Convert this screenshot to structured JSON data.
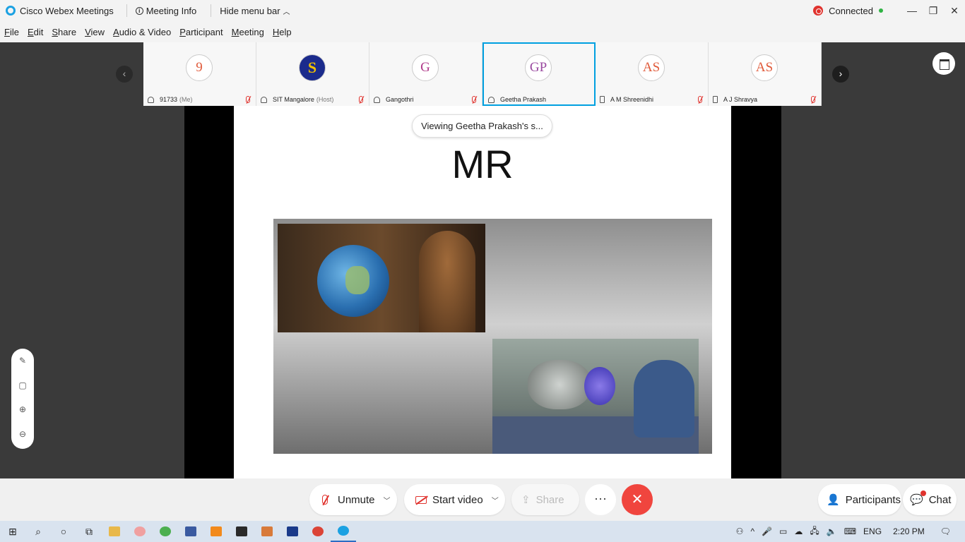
{
  "titlebar": {
    "app_name": "Cisco Webex Meetings",
    "meeting_info": "Meeting Info",
    "hide_menu": "Hide menu bar",
    "status": "Connected",
    "minimize": "—",
    "restore": "❐",
    "close": "✕"
  },
  "menu": {
    "file": "File",
    "edit": "Edit",
    "share": "Share",
    "view": "View",
    "audio_video": "Audio & Video",
    "participant": "Participant",
    "meeting": "Meeting",
    "help": "Help"
  },
  "participants": [
    {
      "initials": "9",
      "name": "91733",
      "role": "(Me)",
      "color": "#e05a3a",
      "device": "headset"
    },
    {
      "initials": "",
      "name": "SIT Mangalore",
      "role": "(Host)",
      "color": "#1b2b8c",
      "device": "headset"
    },
    {
      "initials": "G",
      "name": "Gangothri",
      "role": "",
      "color": "#b03a8a",
      "device": "headset"
    },
    {
      "initials": "GP",
      "name": "Geetha Prakash",
      "role": "",
      "color": "#9a4aa0",
      "device": "headset"
    },
    {
      "initials": "AS",
      "name": "A M Shreenidhi",
      "role": "",
      "color": "#e05a3a",
      "device": "phone"
    },
    {
      "initials": "AS",
      "name": "A J Shravya",
      "role": "",
      "color": "#e05a3a",
      "device": "phone"
    }
  ],
  "strip": {
    "prev": "‹",
    "next": "›"
  },
  "stage": {
    "viewing": "Viewing Geetha Prakash's s...",
    "slide_title": "MR"
  },
  "annotation": {
    "pen": "✎",
    "eraser": "▢",
    "zoom_in": "⊕",
    "zoom_out": "⊖"
  },
  "controls": {
    "unmute": "Unmute",
    "start_video": "Start video",
    "share": "Share",
    "more": "···",
    "end": "✕",
    "participants": "Participants",
    "chat": "Chat"
  },
  "taskbar": {
    "language": "ENG",
    "time": "2:20 PM"
  }
}
